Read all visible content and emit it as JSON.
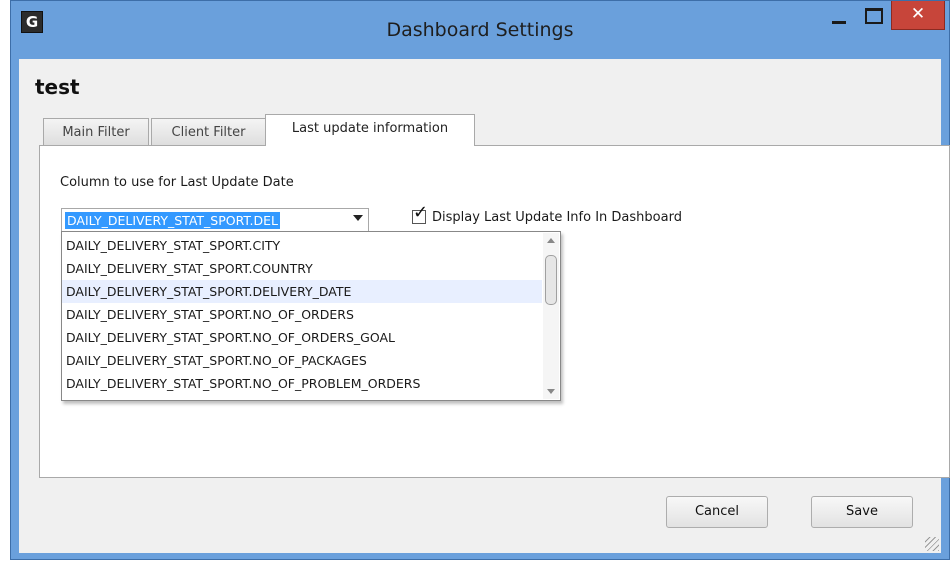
{
  "window": {
    "app_icon_letter": "G",
    "title": "Dashboard Settings",
    "close_glyph": "✕"
  },
  "dialog": {
    "heading": "test",
    "tabs": [
      {
        "label": "Main Filter"
      },
      {
        "label": "Client Filter"
      },
      {
        "label": "Last update information",
        "active": true
      }
    ]
  },
  "last_update": {
    "column_label": "Column to use for Last Update Date",
    "selected_value": "DAILY_DELIVERY_STAT_SPORT.DEL",
    "checkbox_label": "Display Last Update Info In Dashboard",
    "checkbox_checked": true,
    "check_glyph": "✓",
    "options": [
      "DAILY_DELIVERY_STAT_SPORT.CITY",
      "DAILY_DELIVERY_STAT_SPORT.COUNTRY",
      "DAILY_DELIVERY_STAT_SPORT.DELIVERY_DATE",
      "DAILY_DELIVERY_STAT_SPORT.NO_OF_ORDERS",
      "DAILY_DELIVERY_STAT_SPORT.NO_OF_ORDERS_GOAL",
      "DAILY_DELIVERY_STAT_SPORT.NO_OF_PACKAGES",
      "DAILY_DELIVERY_STAT_SPORT.NO_OF_PROBLEM_ORDERS"
    ],
    "highlighted_option": "DAILY_DELIVERY_STAT_SPORT.DELIVERY_DATE"
  },
  "buttons": {
    "cancel": "Cancel",
    "save": "Save"
  },
  "colors": {
    "title_bar": "#6aa0dc",
    "close_button": "#c7453a",
    "selection": "#3399ff",
    "option_hover": "#e8efff"
  }
}
